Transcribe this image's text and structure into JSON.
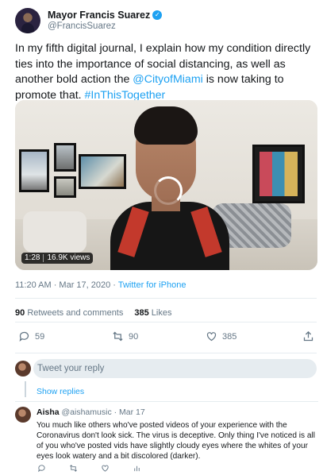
{
  "tweet": {
    "author_name": "Mayor Francis Suarez",
    "author_handle": "@FrancisSuarez",
    "text_before": "In my fifth digital journal, I explain how my condition directly ties into the importance of social distancing, as well as another bold action the ",
    "mention": "@CityofMiami",
    "text_after": " is now taking to promote that. ",
    "hashtag": "#InThisTogether",
    "video": {
      "duration": "1:28",
      "views": "16.9K views"
    },
    "timestamp": "11:20 AM · Mar 17, 2020 · ",
    "source": "Twitter for iPhone",
    "stats": {
      "retweets_count": "90",
      "retweets_label": "Retweets and comments",
      "likes_count": "385",
      "likes_label": "Likes"
    },
    "actions": {
      "reply_icon": "reply-icon",
      "reply_count": "59",
      "retweet_icon": "retweet-icon",
      "retweet_count": "90",
      "like_icon": "heart-icon",
      "like_count": "385",
      "share_icon": "share-icon"
    }
  },
  "reply_composer": {
    "placeholder": "Tweet your reply"
  },
  "thread": {
    "show_replies": "Show replies"
  },
  "reply": {
    "author_name": "Aisha",
    "author_handle": "@aishamusic",
    "date": "· Mar 17",
    "text": "You much like others who've posted videos of your experience with the Coronavirus don't look sick. The virus is deceptive. Only thing I've noticed is all of you who've posted vids have slightly cloudy eyes where the whites of your eyes look watery and a bit discolored (darker)."
  },
  "colors": {
    "accent": "#1da1f2",
    "secondary_text": "#657786",
    "divider": "#e6ecf0"
  }
}
